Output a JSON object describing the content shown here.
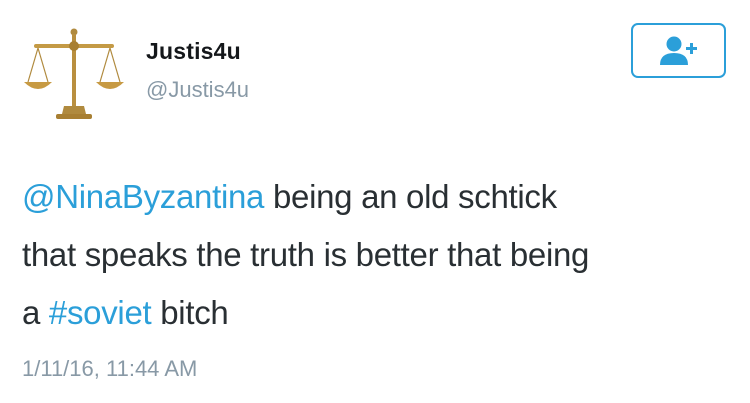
{
  "user": {
    "display_name": "Justis4u",
    "handle": "@Justis4u",
    "avatar_icon": "scales-of-justice-icon"
  },
  "follow_button": {
    "icon": "follow-user-plus-icon",
    "accent_color": "#2b9fd9"
  },
  "tweet": {
    "mention": "@NinaByzantina",
    "line1_rest": " being an old schtick",
    "line2": "that speaks the truth is better that being",
    "line3_prefix": "a ",
    "hashtag": "#soviet",
    "line3_rest": " bitch",
    "timestamp": "1/11/16, 11:44 AM"
  },
  "colors": {
    "link": "#2b9fd9",
    "secondary_text": "#8899a6",
    "primary_text": "#292f33"
  }
}
